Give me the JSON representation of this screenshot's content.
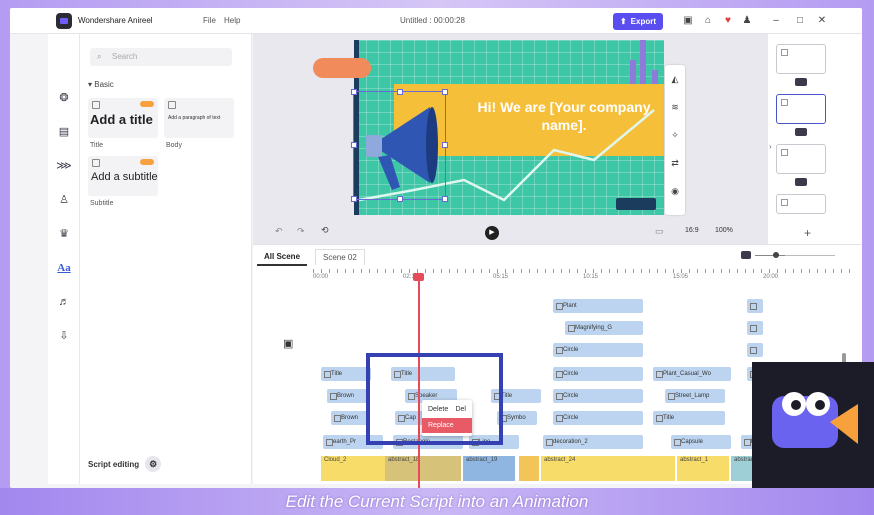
{
  "titlebar": {
    "app_name": "Wondershare Anireel",
    "menu_file": "File",
    "menu_help": "Help",
    "doc_title": "Untitled : 00:00:28",
    "export_label": "Export"
  },
  "left_panel": {
    "search_placeholder": "Search",
    "section": "▾ Basic",
    "cards": [
      {
        "main": "Add a title",
        "caption": "Title"
      },
      {
        "main": "Add a paragraph of text",
        "caption": "Body"
      },
      {
        "main": "Add a subtitle",
        "caption": "Subtitle"
      }
    ],
    "script_editing": "Script editing"
  },
  "canvas": {
    "headline": "Hi! We are [Your company name].",
    "aspect": "16:9",
    "zoom": "100%"
  },
  "timeline": {
    "tabs": [
      "All Scene",
      "Scene 02"
    ],
    "ruler": [
      "00:00",
      "02:13",
      "05:15",
      "10:15",
      "15:05",
      "20:00"
    ],
    "clips": [
      {
        "label": "Plant"
      },
      {
        "label": "Magnifying_G"
      },
      {
        "label": "Circle"
      },
      {
        "label": "Circle"
      },
      {
        "label": "Plant_Casual_Wo"
      },
      {
        "label": "Title"
      },
      {
        "label": "Title"
      },
      {
        "label": "Brown"
      },
      {
        "label": "Speaker"
      },
      {
        "label": "Title"
      },
      {
        "label": "Circle"
      },
      {
        "label": "Street_Lamp"
      },
      {
        "label": "Brown"
      },
      {
        "label": "Cap"
      },
      {
        "label": "Symbo"
      },
      {
        "label": "Circle"
      },
      {
        "label": "Title"
      },
      {
        "label": "earth_Pr"
      },
      {
        "label": "Rectangle"
      },
      {
        "label": "Line"
      },
      {
        "label": "decoration_2"
      },
      {
        "label": "Capsule"
      },
      {
        "label": "Rect"
      }
    ],
    "bottom_clips": [
      "Cloud_2",
      "abstract_18",
      "abstract_19",
      "abstract_24",
      "abstract_1",
      "abstract_1"
    ],
    "context_menu": {
      "delete": "Delete",
      "shortcut": "Del",
      "replace": "Replace"
    }
  },
  "caption": "Edit the Current Script into an Animation",
  "colors": {
    "accent": "#5b4ef0",
    "playhead": "#e64b5a",
    "highlight_box": "#3540b3"
  }
}
